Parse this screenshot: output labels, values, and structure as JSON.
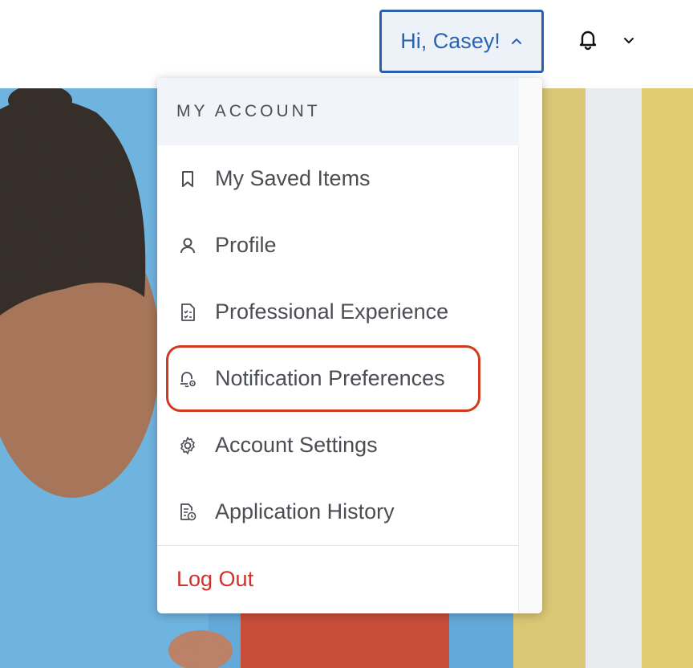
{
  "header": {
    "greeting": "Hi, Casey!"
  },
  "dropdown": {
    "section_title": "MY ACCOUNT",
    "items": [
      {
        "label": "My Saved Items",
        "icon": "bookmark-icon"
      },
      {
        "label": "Profile",
        "icon": "user-icon"
      },
      {
        "label": "Professional Experience",
        "icon": "checklist-document-icon"
      },
      {
        "label": "Notification Preferences",
        "icon": "bell-settings-icon",
        "highlighted": true
      },
      {
        "label": "Account Settings",
        "icon": "gear-icon"
      },
      {
        "label": "Application History",
        "icon": "document-clock-icon"
      }
    ],
    "logout_label": "Log Out"
  },
  "colors": {
    "accent_blue": "#2c5fae",
    "logout_red": "#d0322a",
    "highlight_red": "#d23a1e"
  }
}
